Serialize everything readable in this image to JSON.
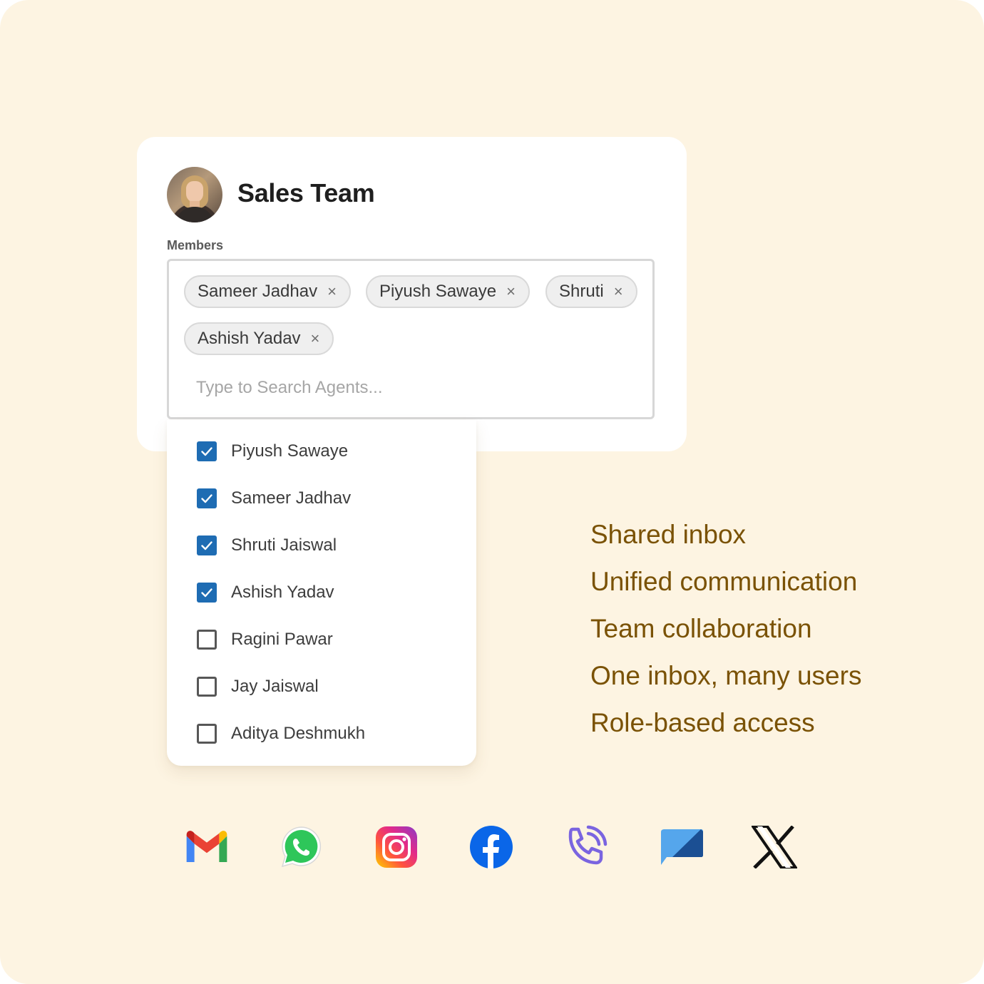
{
  "team": {
    "name": "Sales Team",
    "members_label": "Members"
  },
  "chips": [
    {
      "label": "Sameer Jadhav"
    },
    {
      "label": "Piyush Sawaye"
    },
    {
      "label": "Shruti"
    },
    {
      "label": "Ashish Yadav"
    }
  ],
  "chip_remove_glyph": "×",
  "search": {
    "placeholder": "Type to Search Agents...",
    "value": ""
  },
  "agents": [
    {
      "name": "Piyush Sawaye",
      "checked": true
    },
    {
      "name": "Sameer Jadhav",
      "checked": true
    },
    {
      "name": "Shruti Jaiswal",
      "checked": true
    },
    {
      "name": "Ashish Yadav",
      "checked": true
    },
    {
      "name": "Ragini Pawar",
      "checked": false
    },
    {
      "name": "Jay Jaiswal",
      "checked": false
    },
    {
      "name": "Aditya Deshmukh",
      "checked": false
    }
  ],
  "features": [
    "Shared inbox",
    "Unified communication",
    "Team collaboration",
    "One inbox, many users",
    "Role-based access"
  ],
  "channels": [
    {
      "icon": "gmail-icon"
    },
    {
      "icon": "whatsapp-icon"
    },
    {
      "icon": "instagram-icon"
    },
    {
      "icon": "facebook-icon"
    },
    {
      "icon": "phone-call-icon"
    },
    {
      "icon": "chat-bubble-icon"
    },
    {
      "icon": "x-twitter-icon"
    }
  ],
  "colors": {
    "background": "#fdf4e2",
    "feature_text": "#7a5205",
    "checkbox_checked": "#1e6cb3",
    "card": "#ffffff"
  }
}
